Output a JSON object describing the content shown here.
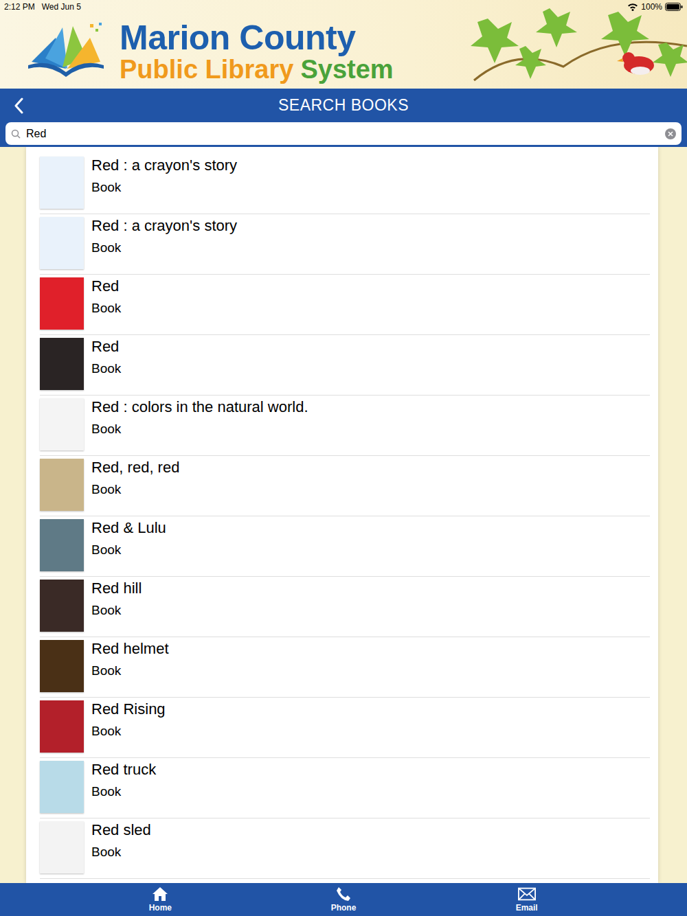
{
  "status_bar": {
    "time": "2:12 PM",
    "date": "Wed Jun 5",
    "battery": "100%"
  },
  "header": {
    "title": "Marion County",
    "subtitle": [
      "Public Library",
      "System"
    ]
  },
  "nav": {
    "title": "SEARCH BOOKS"
  },
  "search": {
    "value": "Red"
  },
  "results": [
    {
      "title": "Red : a crayon's story",
      "type": "Book",
      "color": "#e9f2fb"
    },
    {
      "title": "Red : a crayon's story",
      "type": "Book",
      "color": "#e9f2fb"
    },
    {
      "title": "Red",
      "type": "Book",
      "color": "#e0202a"
    },
    {
      "title": "Red",
      "type": "Book",
      "color": "#2a2424"
    },
    {
      "title": "Red : colors in the natural world.",
      "type": "Book",
      "color": "#f4f4f4"
    },
    {
      "title": "Red, red, red",
      "type": "Book",
      "color": "#c9b58a"
    },
    {
      "title": "Red & Lulu",
      "type": "Book",
      "color": "#5f7a86"
    },
    {
      "title": "Red hill",
      "type": "Book",
      "color": "#3a2a26"
    },
    {
      "title": "Red helmet",
      "type": "Book",
      "color": "#4a3016"
    },
    {
      "title": "Red Rising",
      "type": "Book",
      "color": "#b3202a"
    },
    {
      "title": "Red truck",
      "type": "Book",
      "color": "#b8dbe8"
    },
    {
      "title": "Red sled",
      "type": "Book",
      "color": "#f3f3f3"
    }
  ],
  "tabs": [
    {
      "label": "Home"
    },
    {
      "label": "Phone"
    },
    {
      "label": "Email"
    }
  ]
}
